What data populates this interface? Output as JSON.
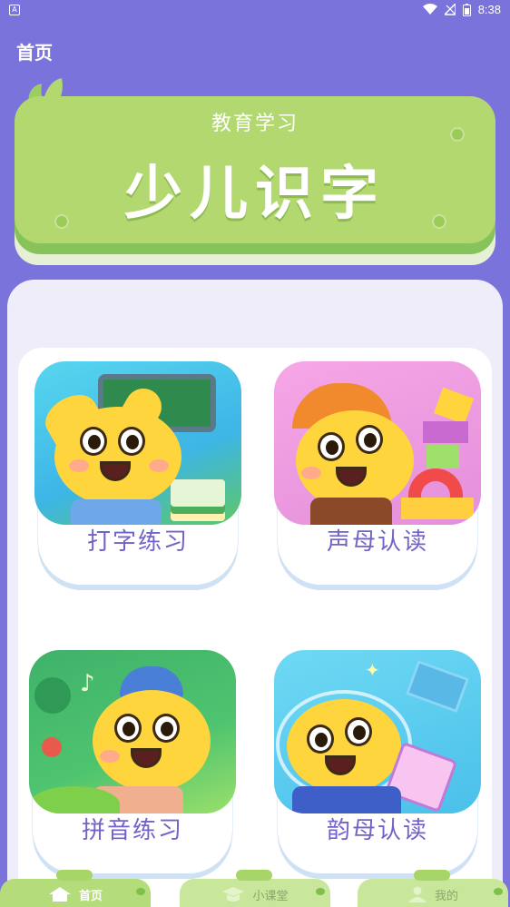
{
  "status_bar": {
    "time": "8:38",
    "icons": [
      "wifi-icon",
      "signal-icon",
      "battery-icon"
    ]
  },
  "header": {
    "title": "首页"
  },
  "banner": {
    "subtitle": "教育学习",
    "title": "少儿识字"
  },
  "courses": [
    {
      "label": "打字练习",
      "icon": "classroom-illustration"
    },
    {
      "label": "声母认读",
      "icon": "blocks-illustration"
    },
    {
      "label": "拼音练习",
      "icon": "forest-illustration"
    },
    {
      "label": "韵母认读",
      "icon": "space-illustration"
    }
  ],
  "nav": {
    "items": [
      {
        "label": "首页",
        "icon": "home-icon",
        "active": true
      },
      {
        "label": "小课堂",
        "icon": "graduation-cap-icon",
        "active": false
      },
      {
        "label": "我的",
        "icon": "user-icon",
        "active": false
      }
    ]
  },
  "colors": {
    "background": "#7b73dc",
    "banner": "#b2d86f",
    "label_text": "#7163c8",
    "nav": "#b5dc7a"
  }
}
